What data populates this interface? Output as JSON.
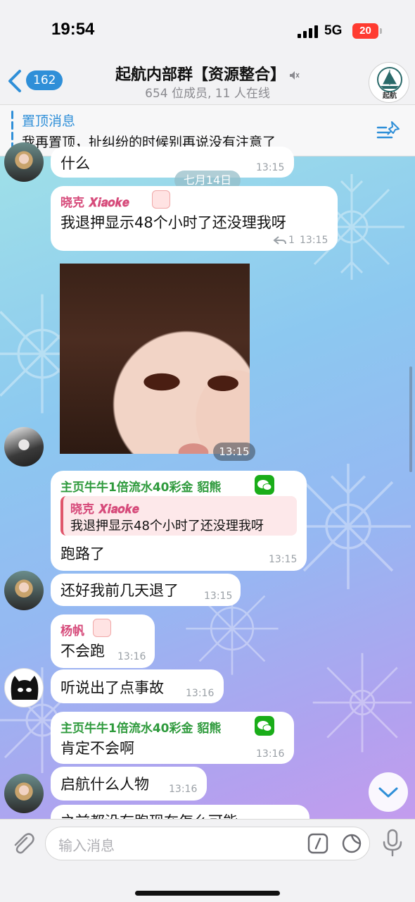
{
  "status_bar": {
    "time": "19:54",
    "network": "5G",
    "battery": "20"
  },
  "header": {
    "back_count": "162",
    "title": "起航内部群【资源整合】",
    "subtitle": "654 位成员, 11 人在线",
    "avatar_text": "起航"
  },
  "pinned": {
    "title": "置顶消息",
    "text": "我再置顶，扯纠纷的时候别再说没有注意了"
  },
  "date_divider": "七月14日",
  "messages": [
    {
      "text": "什么",
      "time": "13:15"
    },
    {
      "sender": "晓克 𝑿𝒊𝒂𝒐𝒌𝒆",
      "text": "我退押显示48个小时了还没理我呀",
      "reply_count": "1",
      "time": "13:15"
    },
    {
      "time": "13:15"
    },
    {
      "sender": "主页牛牛1倍流水40彩金 貂熊",
      "reply_sender": "晓克 𝑿𝒊𝒂𝒐𝒌𝒆",
      "reply_text": "我退押显示48个小时了还没理我呀",
      "text": "跑路了",
      "time": "13:15"
    },
    {
      "text": "还好我前几天退了",
      "time": "13:15"
    },
    {
      "sender": "杨帆",
      "text": "不会跑",
      "time": "13:16"
    },
    {
      "text": "听说出了点事故",
      "time": "13:16"
    },
    {
      "sender": "主页牛牛1倍流水40彩金 貂熊",
      "text": "肯定不会啊",
      "time": "13:16"
    },
    {
      "text": "启航什么人物",
      "time": "13:16"
    },
    {
      "text": "之前都没有跑现在怎么可能"
    }
  ],
  "composer": {
    "placeholder": "输入消息"
  },
  "colors": {
    "accent": "#2f8fd8",
    "sender_green": "#2e9a3c",
    "sender_pink": "#d64a7a"
  },
  "icons": [
    "back-chevron-icon",
    "mute-icon",
    "pin-list-icon",
    "paperclip-icon",
    "slash-command-icon",
    "sticker-icon",
    "microphone-icon",
    "chevron-down-icon",
    "reply-icon",
    "wechat-icon"
  ]
}
